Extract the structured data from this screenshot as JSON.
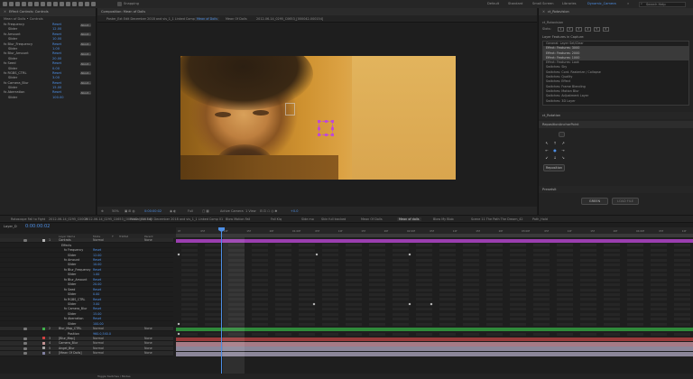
{
  "topbar": {
    "workspaces": [
      "Default",
      "Standard",
      "Small Screen",
      "Libraries",
      "Dynamic_Camera"
    ],
    "active_workspace": "Dynamic_Camera",
    "snapping": "Snapping",
    "search_placeholder": "Search Help"
  },
  "effect_controls": {
    "title": "Effect Controls: Controls",
    "subtitle": "Mean of Dolls • Controls",
    "rows": [
      {
        "name": "fx Frequency",
        "value": "Reset",
        "btn": "About..."
      },
      {
        "name": "Slider",
        "value": "12.00",
        "btn": ""
      },
      {
        "name": "fx Amount",
        "value": "Reset",
        "btn": "About..."
      },
      {
        "name": "Slider",
        "value": "10.00",
        "btn": ""
      },
      {
        "name": "fx Blur_Frequency",
        "value": "Reset",
        "btn": "About..."
      },
      {
        "name": "Slider",
        "value": "1.00",
        "btn": ""
      },
      {
        "name": "fx Blur_Amount",
        "value": "Reset",
        "btn": "About..."
      },
      {
        "name": "Slider",
        "value": "20.00",
        "btn": ""
      },
      {
        "name": "fx Seed",
        "value": "Reset",
        "btn": "About..."
      },
      {
        "name": "Slider",
        "value": "0.00",
        "btn": ""
      },
      {
        "name": "fx RGBS_CTRL",
        "value": "Reset",
        "btn": "About..."
      },
      {
        "name": "Slider",
        "value": "3.00",
        "btn": ""
      },
      {
        "name": "fx Camera_Blur",
        "value": "Reset",
        "btn": "About..."
      },
      {
        "name": "Slider",
        "value": "15.00",
        "btn": ""
      },
      {
        "name": "fx Aberration",
        "value": "Reset",
        "btn": "About..."
      },
      {
        "name": "Slider",
        "value": "100.00",
        "btn": ""
      }
    ]
  },
  "composition": {
    "title": "Composition: Mean of Dolls",
    "tabs": [
      "Poster_Ext Edit December 2018 and vis_1_1 Linked Comp 01",
      "Mean of Dolls",
      "Mean Of Dolls",
      "2012-06-14_0295_C0653_[000042-000154]"
    ],
    "active_tab": "Mean of Dolls",
    "toolbar": [
      "50%",
      "0:00:00:02",
      "Full",
      "Active Camera",
      "1 View",
      "+0.0"
    ]
  },
  "fx_console": {
    "title": "ct_Rotavision",
    "subtitle": "ct_Rotavision",
    "slots_label": "Slots:",
    "slots": [
      "1",
      "2",
      "3",
      "4",
      "5",
      "6"
    ],
    "list_title": "Layer Features in Capture:",
    "list": [
      "General: Layer Set/Clear",
      "Effect: Features: 3000",
      "Effect: Features: 2000",
      "Effect: Features: 1000",
      "Effect: Features: Look",
      "Switches: Sky",
      "Switches: Cont. Rasterize / Collapse",
      "Switches: Quality",
      "Switches: Effect",
      "Switches: Frame Blending",
      "Switches: Motion Blur",
      "Switches: Adjustment Layer",
      "Switches: 3D Layer"
    ],
    "selected": [
      1,
      2,
      3
    ],
    "panel2_title": "ct_Rotation",
    "reposition_title": "RepositionAnchorPoint",
    "reposition_btn": "Reposition",
    "presets_title": "PresetsIt",
    "btn_left": "GREEN",
    "btn_right": "LOAD FILE"
  },
  "timeline": {
    "tabs": [
      "Rotoscope Fall to Fight",
      "2012-06-14_0295_C0009",
      "2012-06-14_0295_C0653_[000042-000154]",
      "Poster_Ext Edit December 2018 and vis_1_1 Linked Comp 01",
      "Blow Motion Fall",
      "Fall Kiq",
      "Side mo",
      "Skin full tracked",
      "Mean Of Dolls",
      "Mean of dolls",
      "Blow My Blob",
      "Scene 11 The Path The Dream_42",
      "Path_Hold"
    ],
    "active_tab": "Mean of dolls",
    "comp_name": "Layer_D",
    "timecode": "0:00:00:02",
    "col_headers": [
      "Layer Name",
      "Mode",
      "T",
      "TrkMat",
      "Parent"
    ],
    "ruler": [
      "0f",
      "05f",
      "10f",
      "15f",
      "20f",
      "01:00f",
      "05f",
      "10f",
      "15f",
      "20f",
      "02:00f",
      "05f",
      "10f",
      "15f",
      "20f",
      "03:00f",
      "05f",
      "10f",
      "15f",
      "20f",
      "04:00f",
      "05f",
      "10f"
    ],
    "layers": [
      {
        "num": "1",
        "name": "Controls",
        "mode": "Normal",
        "parent": "None",
        "color": "#b5b5b5",
        "kind": "layer"
      },
      {
        "num": "",
        "name": "Effects",
        "mode": "",
        "parent": "",
        "kind": "sub"
      },
      {
        "num": "",
        "name": "fx Frequency",
        "mode": "Reset",
        "parent": "",
        "kind": "fx"
      },
      {
        "num": "",
        "name": "Slider",
        "mode": "12.00",
        "parent": "",
        "kind": "prop"
      },
      {
        "num": "",
        "name": "fx Amount",
        "mode": "Reset",
        "parent": "",
        "kind": "fx"
      },
      {
        "num": "",
        "name": "Slider",
        "mode": "10.00",
        "parent": "",
        "kind": "prop"
      },
      {
        "num": "",
        "name": "fx Blur_Frequency",
        "mode": "Reset",
        "parent": "",
        "kind": "fx"
      },
      {
        "num": "",
        "name": "Slider",
        "mode": "1.00",
        "parent": "",
        "kind": "prop"
      },
      {
        "num": "",
        "name": "fx Blur_Amount",
        "mode": "Reset",
        "parent": "",
        "kind": "fx"
      },
      {
        "num": "",
        "name": "Slider",
        "mode": "20.00",
        "parent": "",
        "kind": "prop"
      },
      {
        "num": "",
        "name": "fx Seed",
        "mode": "Reset",
        "parent": "",
        "kind": "fx"
      },
      {
        "num": "",
        "name": "Slider",
        "mode": "0.00",
        "parent": "",
        "kind": "prop"
      },
      {
        "num": "",
        "name": "fx RGBS_CTRL",
        "mode": "Reset",
        "parent": "",
        "kind": "fx"
      },
      {
        "num": "",
        "name": "Slider",
        "mode": "3.00",
        "parent": "",
        "kind": "prop"
      },
      {
        "num": "",
        "name": "fx Camera_Blur",
        "mode": "Reset",
        "parent": "",
        "kind": "fx"
      },
      {
        "num": "",
        "name": "Slider",
        "mode": "15.00",
        "parent": "",
        "kind": "prop"
      },
      {
        "num": "",
        "name": "fx Aberration",
        "mode": "Reset",
        "parent": "",
        "kind": "fx"
      },
      {
        "num": "",
        "name": "Slider",
        "mode": "100.00",
        "parent": "",
        "kind": "prop"
      },
      {
        "num": "2",
        "name": "Blur_Map_CTRL",
        "mode": "Normal",
        "parent": "None",
        "color": "#3fb04a",
        "kind": "layer"
      },
      {
        "num": "",
        "name": "Position",
        "mode": "960.0,540.0",
        "parent": "",
        "kind": "prop"
      },
      {
        "num": "3",
        "name": "[Blur_Map]",
        "mode": "Normal",
        "parent": "None",
        "color": "#d04040",
        "kind": "layer"
      },
      {
        "num": "4",
        "name": "Camera_Blur",
        "mode": "Normal",
        "parent": "None",
        "color": "#c09090",
        "kind": "layer"
      },
      {
        "num": "5",
        "name": "Angel_Blur",
        "mode": "Normal",
        "parent": "None",
        "color": "#a0a0a0",
        "kind": "layer"
      },
      {
        "num": "6",
        "name": "[Mean Of Dolls]",
        "mode": "Normal",
        "parent": "None",
        "color": "#8080a0",
        "kind": "layer"
      }
    ],
    "bottom": "Toggle Switches / Modes"
  },
  "colors": {
    "accent": "#4d8fe6",
    "purple_bar": "#9b3fb0",
    "green_bar": "#2f8a3a",
    "red_bar": "#9a3a3a",
    "pink_bar": "#a57b86",
    "lilac_bar": "#8b8699"
  }
}
